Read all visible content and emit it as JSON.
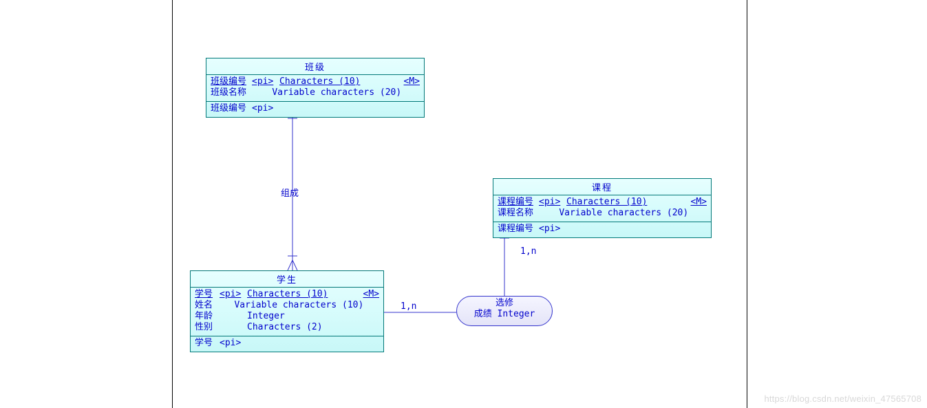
{
  "entities": {
    "class": {
      "title": "班级",
      "attrs": [
        {
          "name": "班级编号",
          "pi": "<pi>",
          "type": "Characters (10)",
          "m": "<M>",
          "underline": true
        },
        {
          "name": "班级名称",
          "pi": "",
          "type": "Variable characters (20)",
          "m": "",
          "underline": false
        }
      ],
      "footer_name": "班级编号",
      "footer_pi": "<pi>"
    },
    "student": {
      "title": "学生",
      "attrs": [
        {
          "name": "学号",
          "pi": "<pi>",
          "type": "Characters (10)",
          "m": "<M>",
          "underline": true
        },
        {
          "name": "姓名",
          "pi": "",
          "type": "Variable characters (10)",
          "m": "",
          "underline": false
        },
        {
          "name": "年龄",
          "pi": "",
          "type": "Integer",
          "m": "",
          "underline": false
        },
        {
          "name": "性别",
          "pi": "",
          "type": "Characters (2)",
          "m": "",
          "underline": false
        }
      ],
      "footer_name": "学号",
      "footer_pi": "<pi>"
    },
    "course": {
      "title": "课程",
      "attrs": [
        {
          "name": "课程编号",
          "pi": "<pi>",
          "type": "Characters (10)",
          "m": "<M>",
          "underline": true
        },
        {
          "name": "课程名称",
          "pi": "",
          "type": "Variable characters (20)",
          "m": "",
          "underline": false
        }
      ],
      "footer_name": "课程编号",
      "footer_pi": "<pi>"
    }
  },
  "relationship": {
    "title": "选修",
    "attr": "成绩  Integer"
  },
  "links": {
    "compose_label": "组成",
    "card_student_select": "1,n",
    "card_course_select": "1,n"
  },
  "watermark": "https://blog.csdn.net/weixin_47565708"
}
